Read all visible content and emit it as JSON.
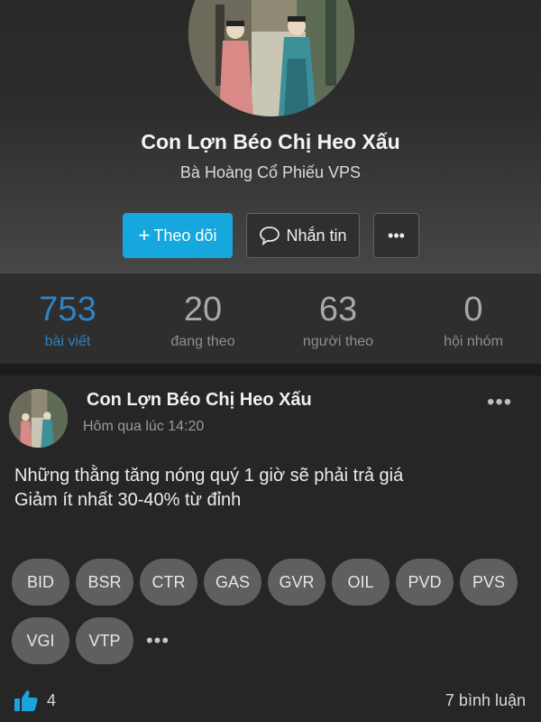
{
  "profile": {
    "name": "Con Lợn Béo Chị Heo Xấu",
    "subtitle": "Bà Hoàng Cổ Phiếu VPS",
    "follow_label": "Theo dõi",
    "message_label": "Nhắn tin",
    "more_label": "•••",
    "accent_color": "#17a7df"
  },
  "stats": [
    {
      "value": "753",
      "label": "bài viết"
    },
    {
      "value": "20",
      "label": "đang theo"
    },
    {
      "value": "63",
      "label": "người theo"
    },
    {
      "value": "0",
      "label": "hội nhóm"
    }
  ],
  "post": {
    "author": "Con Lợn Béo Chị Heo Xấu",
    "time": "Hôm qua lúc 14:20",
    "more_label": "•••",
    "lines": [
      "Những thằng tăng nóng quý 1 giờ sẽ phải trả giá",
      "Giảm ít nhất 30-40% từ đỉnh"
    ],
    "tags": [
      "BID",
      "BSR",
      "CTR",
      "GAS",
      "GVR",
      "OIL",
      "PVD",
      "PVS",
      "VGI",
      "VTP"
    ],
    "tags_more": "•••",
    "likes": "4",
    "comments": "7 bình luận"
  }
}
